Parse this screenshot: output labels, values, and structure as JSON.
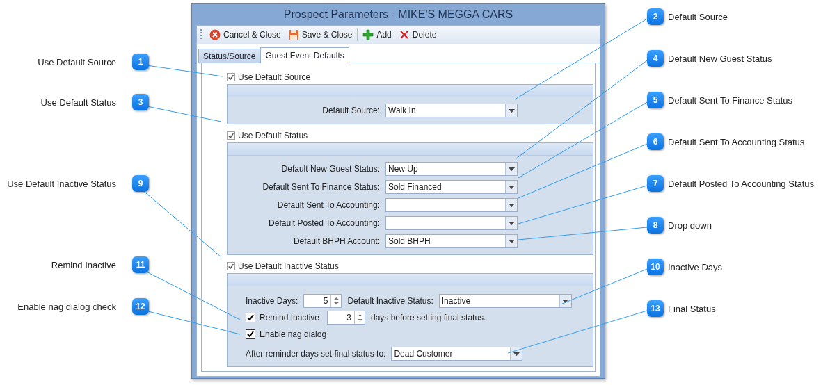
{
  "window": {
    "title": "Prospect Parameters - MIKE'S MEGGA CARS"
  },
  "toolbar": {
    "buttons": [
      {
        "kind": "cancel",
        "label": "Cancel & Close"
      },
      {
        "kind": "save",
        "label": "Save & Close"
      },
      {
        "kind": "add",
        "label": "Add"
      },
      {
        "kind": "delete",
        "label": "Delete"
      }
    ]
  },
  "tabs": [
    {
      "label": "Status/Source",
      "selected": false
    },
    {
      "label": "Guest Event Defaults",
      "selected": true
    }
  ],
  "groups": [
    {
      "label": "Use Default Source",
      "checked": true,
      "fields": [
        {
          "label": "Default Source:",
          "value": "Walk In"
        }
      ]
    },
    {
      "label": "Use Default Status",
      "checked": true,
      "fields": [
        {
          "label": "Default New Guest Status:",
          "value": "New Up"
        },
        {
          "label": "Default Sent To Finance Status:",
          "value": "Sold Financed"
        },
        {
          "label": "Default Sent To Accounting:"
        },
        {
          "label": "Default Posted To Accounting:"
        },
        {
          "label": "Default BHPH Account:",
          "value": "Sold BHPH"
        }
      ]
    }
  ],
  "inactive_group": {
    "label": "Use Default Inactive Status",
    "checked": true,
    "inactive_days": {
      "label": "Inactive Days:",
      "value": "5"
    },
    "inactive_status": {
      "label": "Default Inactive Status:",
      "value": "Inactive"
    },
    "remind": {
      "label": "Remind Inactive",
      "checked": true,
      "value": "3",
      "suffix": "days before setting final status."
    },
    "nag": {
      "label": "Enable nag dialog",
      "checked": true
    },
    "final_status": {
      "label": "After reminder days set final status to:",
      "value": "Dead Customer"
    }
  },
  "left_callouts": [
    {
      "number": "1",
      "label": "Use Default Source"
    },
    {
      "number": "3",
      "label": "Use Default Status"
    },
    {
      "number": "9",
      "label": "Use Default Inactive Status"
    },
    {
      "number": "11",
      "label": "Remind Inactive"
    },
    {
      "number": "12",
      "label": "Enable nag dialog check"
    }
  ],
  "right_callouts": [
    {
      "number": "2",
      "label": "Default Source"
    },
    {
      "number": "4",
      "label": "Default New Guest Status"
    },
    {
      "number": "5",
      "label": "Default Sent To Finance Status"
    },
    {
      "number": "6",
      "label": "Default Sent To Accounting Status"
    },
    {
      "number": "7",
      "label": "Default Posted To Accounting Status"
    },
    {
      "number": "8",
      "label": "Drop down"
    },
    {
      "number": "10",
      "label": "Inactive Days"
    },
    {
      "number": "13",
      "label": "Final Status"
    }
  ]
}
